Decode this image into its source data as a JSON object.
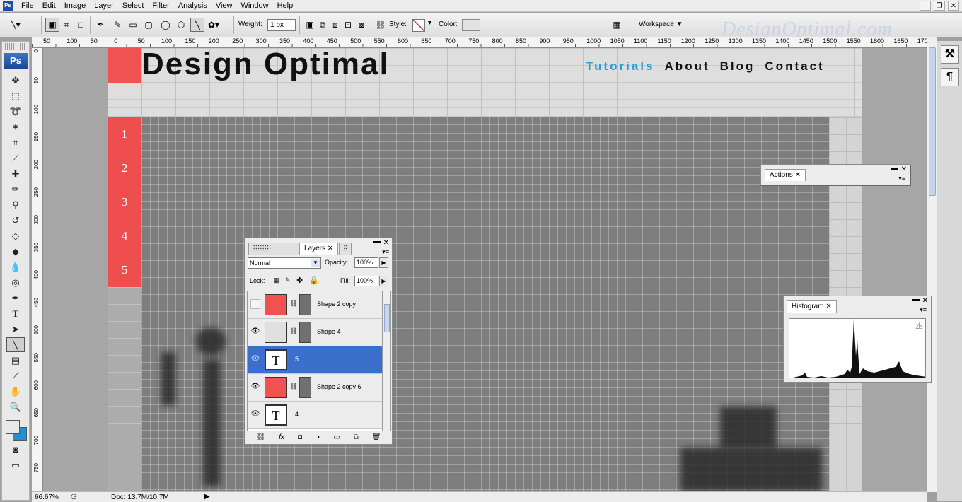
{
  "menu": [
    "File",
    "Edit",
    "Image",
    "Layer",
    "Select",
    "Filter",
    "Analysis",
    "View",
    "Window",
    "Help"
  ],
  "app_icon": "Ps",
  "options": {
    "weight_label": "Weight:",
    "weight_value": "1 px",
    "style_label": "Style:",
    "color_label": "Color:",
    "workspace_label": "Workspace ▼",
    "accent_color": "#e2e2e2"
  },
  "watermark": "DesignOptimal.com",
  "toolbox": {
    "logo": "Ps",
    "tools": [
      "move-icon",
      "marquee-icon",
      "lasso-icon",
      "magic-wand-icon",
      "crop-icon",
      "eyedropper-icon",
      "healing-brush-icon",
      "brush-icon",
      "clone-stamp-icon",
      "history-brush-icon",
      "eraser-icon",
      "paint-bucket-icon",
      "blur-icon",
      "dodge-icon",
      "pen-icon",
      "type-icon",
      "path-selection-icon",
      "line-icon",
      "notes-icon",
      "color-sampler-icon",
      "hand-icon",
      "zoom-icon"
    ],
    "fg_color": "#e8e8e8",
    "bg_color": "#1e90d8"
  },
  "ruler_top_labels": [
    "50",
    "100",
    "50",
    "0",
    "50",
    "100",
    "150",
    "200",
    "250",
    "300",
    "350",
    "400",
    "450",
    "500",
    "550",
    "600",
    "650",
    "700",
    "750",
    "800",
    "850",
    "900",
    "950",
    "1000",
    "1050",
    "1100",
    "1150",
    "1200",
    "1250",
    "1300",
    "1350",
    "1400",
    "1450",
    "1500",
    "1550",
    "1600",
    "1650",
    "1700"
  ],
  "ruler_left_labels": [
    "0",
    "50",
    "100",
    "150",
    "200",
    "250",
    "300",
    "350",
    "400",
    "450",
    "500",
    "550",
    "600",
    "650",
    "700",
    "750",
    "800"
  ],
  "canvas": {
    "site_title": "Design Optimal",
    "nav": [
      "Tutorials",
      "About",
      "Blog",
      "Contact"
    ],
    "nav_active_color": "#2a9ad6",
    "side_numbers": [
      "1",
      "2",
      "3",
      "4",
      "5"
    ],
    "accent_red": "#f05252"
  },
  "panels": {
    "actions_tab": "Actions",
    "histogram_tab": "Histogram",
    "layers_tab": "Layers",
    "blend_mode": "Normal",
    "opacity_label": "Opacity:",
    "opacity_value": "100%",
    "lock_label": "Lock:",
    "fill_label": "Fill:",
    "fill_value": "100%",
    "layers": [
      {
        "name": "Shape 2 copy",
        "kind": "shape-red",
        "visible": false,
        "selected": false
      },
      {
        "name": "Shape 4",
        "kind": "shape-gray",
        "visible": true,
        "selected": false
      },
      {
        "name": "5",
        "kind": "text",
        "visible": true,
        "selected": true
      },
      {
        "name": "Shape 2 copy 6",
        "kind": "shape-red",
        "visible": true,
        "selected": false
      },
      {
        "name": "4",
        "kind": "text",
        "visible": true,
        "selected": false
      }
    ]
  },
  "status": {
    "zoom": "66.67%",
    "doc": "Doc: 13.7M/10.7M"
  }
}
